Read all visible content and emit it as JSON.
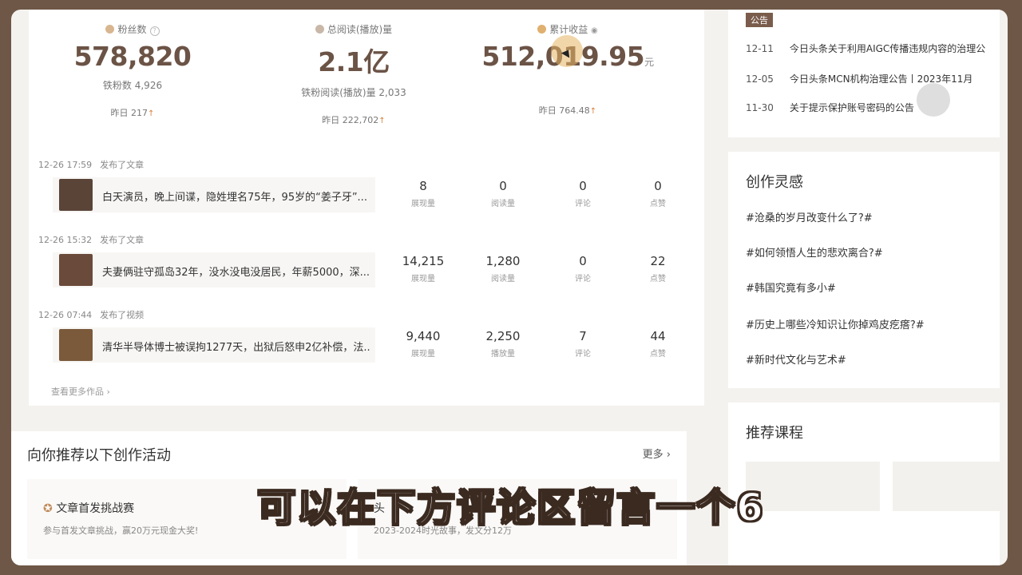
{
  "stats": [
    {
      "label": "粉丝数",
      "value": "578,820",
      "sub_label": "铁粉数",
      "sub_value": "4,926",
      "yday_label": "昨日",
      "yday_value": "217"
    },
    {
      "label": "总阅读(播放)量",
      "value": "2.1亿",
      "sub_label": "铁粉阅读(播放)量",
      "sub_value": "2,033",
      "yday_label": "昨日",
      "yday_value": "222,702"
    },
    {
      "label": "累计收益",
      "value": "512,019.95",
      "unit": "元",
      "yday_label": "昨日",
      "yday_value": "764.48"
    }
  ],
  "posts": [
    {
      "time": "12-26 17:59",
      "action": "发布了文章",
      "title": "白天演员，晚上间谍，隐姓埋名75年，95岁的“姜子牙”...",
      "metrics": [
        {
          "v": "8",
          "l": "展现量"
        },
        {
          "v": "0",
          "l": "阅读量"
        },
        {
          "v": "0",
          "l": "评论"
        },
        {
          "v": "0",
          "l": "点赞"
        }
      ]
    },
    {
      "time": "12-26 15:32",
      "action": "发布了文章",
      "title": "夫妻俩驻守孤岛32年，没水没电没居民，年薪5000，深...",
      "metrics": [
        {
          "v": "14,215",
          "l": "展现量"
        },
        {
          "v": "1,280",
          "l": "阅读量"
        },
        {
          "v": "0",
          "l": "评论"
        },
        {
          "v": "22",
          "l": "点赞"
        }
      ]
    },
    {
      "time": "12-26 07:44",
      "action": "发布了视频",
      "title": "清华半导体博士被误拘1277天，出狱后怒申2亿补偿，法...",
      "metrics": [
        {
          "v": "9,440",
          "l": "展现量"
        },
        {
          "v": "2,250",
          "l": "播放量"
        },
        {
          "v": "7",
          "l": "评论"
        },
        {
          "v": "44",
          "l": "点赞"
        }
      ]
    }
  ],
  "more_works": "查看更多作品",
  "notice": {
    "tag": "公告",
    "items": [
      {
        "date": "12-11",
        "text": "今日头条关于利用AIGC传播违规内容的治理公"
      },
      {
        "date": "12-05",
        "text": "今日头条MCN机构治理公告丨2023年11月"
      },
      {
        "date": "11-30",
        "text": "关于提示保护账号密码的公告"
      }
    ]
  },
  "inspiration": {
    "title": "创作灵感",
    "items": [
      "#沧桑的岁月改变什么了?#",
      "#如何领悟人生的悲欢离合?#",
      "#韩国究竟有多小#",
      "#历史上哪些冷知识让你掉鸡皮疙瘩?#",
      "#新时代文化与艺术#"
    ]
  },
  "courses": {
    "title": "推荐课程"
  },
  "activities": {
    "title": "向你推荐以下创作活动",
    "more": "更多",
    "items": [
      {
        "name": "文章首发挑战赛",
        "desc": "参与首发文章挑战，赢20万元现金大奖!"
      },
      {
        "name": "头",
        "desc": "2023-2024时光故事，发文分12万"
      }
    ]
  },
  "subtitle": "可以在下方评论区留言一个6",
  "colors": {
    "accent": "#6b5346",
    "up_arrow": "#d9803a",
    "frame": "#6e5747"
  }
}
